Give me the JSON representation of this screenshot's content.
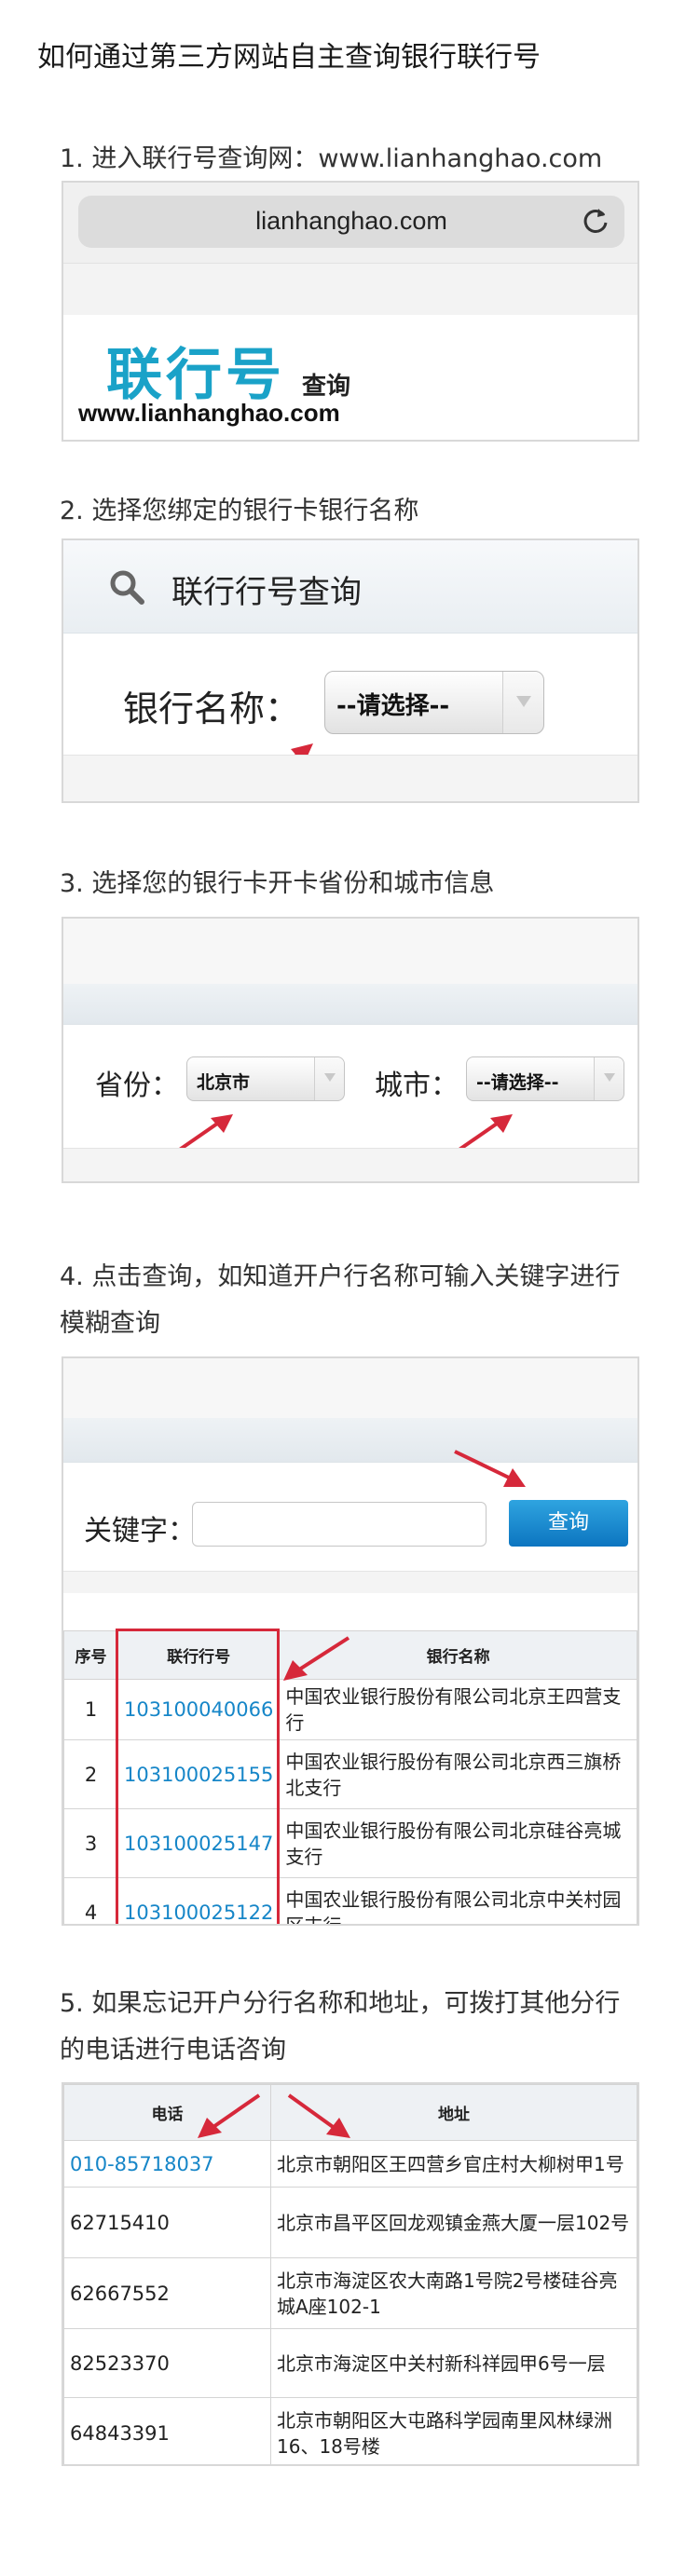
{
  "article": {
    "title": "如何通过第三方网站自主查询银行联行号"
  },
  "steps": {
    "s1": "1. 进入联行号查询网：www.lianhanghao.com",
    "s2": "2. 选择您绑定的银行卡银行名称",
    "s3": "3. 选择您的银行卡开卡省份和城市信息",
    "s4_line1": "4. 点击查询，如知道开户行名称可输入关键字进行",
    "s4_line2": "模糊查询",
    "s5_line1": "5. 如果忘记开户分行名称和地址，可拨打其他分行",
    "s5_line2": "的电话进行电话咨询"
  },
  "browser": {
    "url": "lianhanghao.com",
    "reload_icon": "reload-icon"
  },
  "logo": {
    "main": "联行号",
    "sub": "查询",
    "url": "www.lianhanghao.com"
  },
  "bank_query": {
    "title": "联行行号查询",
    "search_icon": "search-icon",
    "bank_label": "银行名称：",
    "bank_select": "--请选择--"
  },
  "region": {
    "province_label": "省份：",
    "province_value": "北京市",
    "city_label": "城市：",
    "city_value": "--请选择--"
  },
  "search": {
    "keyword_label": "关键字：",
    "keyword_value": "",
    "button": "查询"
  },
  "results": {
    "headers": [
      "序号",
      "联行行号",
      "银行名称"
    ],
    "rows": [
      {
        "no": "1",
        "code": "103100040066",
        "bank": "中国农业银行股份有限公司北京王四营支行"
      },
      {
        "no": "2",
        "code": "103100025155",
        "bank": "中国农业银行股份有限公司北京西三旗桥北支行"
      },
      {
        "no": "3",
        "code": "103100025147",
        "bank": "中国农业银行股份有限公司北京硅谷亮城支行"
      },
      {
        "no": "4",
        "code": "103100025122",
        "bank": "中国农业银行股份有限公司北京中关村园区支行"
      }
    ]
  },
  "contacts": {
    "headers": [
      "电话",
      "地址"
    ],
    "rows": [
      {
        "phone": "010-85718037",
        "address": "北京市朝阳区王四营乡官庄村大柳树甲1号"
      },
      {
        "phone": "62715410",
        "address": "北京市昌平区回龙观镇金燕大厦一层102号"
      },
      {
        "phone": "62667552",
        "address": "北京市海淀区农大南路1号院2号楼硅谷亮城A座102-1"
      },
      {
        "phone": "82523370",
        "address": "北京市海淀区中关村新科祥园甲6号一层"
      },
      {
        "phone": "64843391",
        "address": "北京市朝阳区大屯路科学园南里风林绿洲16、18号楼"
      }
    ]
  },
  "colors": {
    "accent": "#1aa2c8",
    "link": "#1686c8",
    "arrow": "#d6283a",
    "button": "#0c75c0"
  }
}
